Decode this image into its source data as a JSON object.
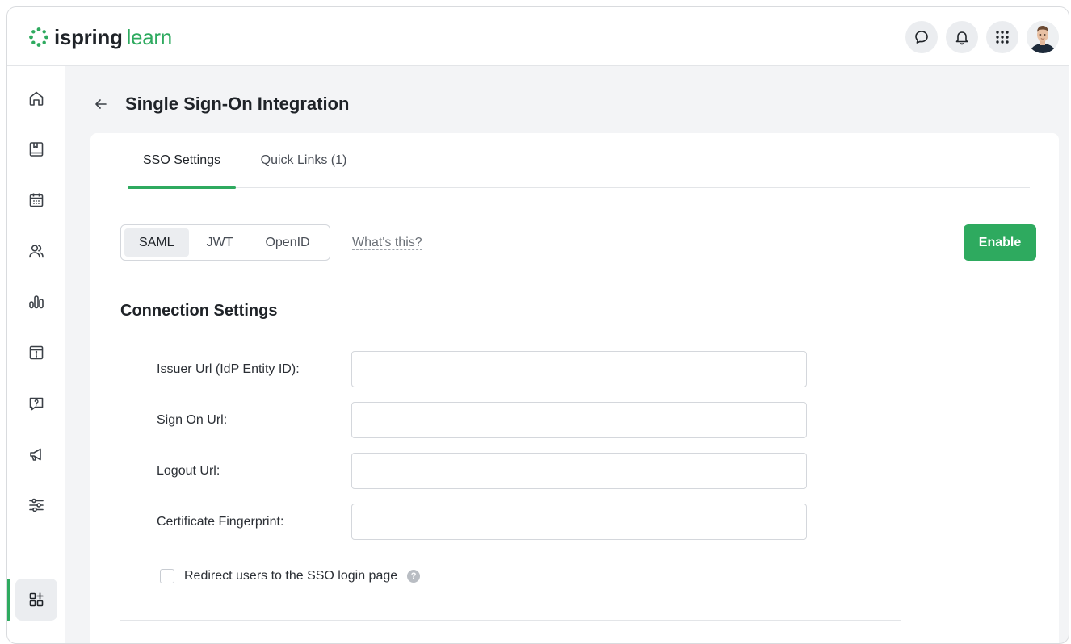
{
  "brand": {
    "name_bold": "ispring",
    "name_light": "learn",
    "accent_color": "#2eaa5f"
  },
  "header": {
    "icons": [
      "chat-icon",
      "bell-icon",
      "apps-grid-icon"
    ],
    "avatar": "user-avatar"
  },
  "sidebar": {
    "items": [
      {
        "icon": "home-icon",
        "active": false
      },
      {
        "icon": "book-icon",
        "active": false
      },
      {
        "icon": "calendar-icon",
        "active": false
      },
      {
        "icon": "users-icon",
        "active": false
      },
      {
        "icon": "reports-icon",
        "active": false
      },
      {
        "icon": "info-box-icon",
        "active": false
      },
      {
        "icon": "question-chat-icon",
        "active": false
      },
      {
        "icon": "megaphone-icon",
        "active": false
      },
      {
        "icon": "sliders-icon",
        "active": false
      },
      {
        "icon": "integrations-icon",
        "active": true
      }
    ]
  },
  "page": {
    "title": "Single Sign-On Integration"
  },
  "tabs": [
    {
      "label": "SSO Settings",
      "active": true
    },
    {
      "label": "Quick Links (1)",
      "active": false
    }
  ],
  "protocol": {
    "options": [
      {
        "label": "SAML",
        "active": true
      },
      {
        "label": "JWT",
        "active": false
      },
      {
        "label": "OpenID",
        "active": false
      }
    ],
    "help_link": "What's this?",
    "enable_label": "Enable"
  },
  "connection": {
    "title": "Connection Settings",
    "fields": [
      {
        "label": "Issuer Url (IdP Entity ID):",
        "value": "",
        "placeholder": ""
      },
      {
        "label": "Sign On Url:",
        "value": "",
        "placeholder": ""
      },
      {
        "label": "Logout Url:",
        "value": "",
        "placeholder": ""
      },
      {
        "label": "Certificate Fingerprint:",
        "value": "",
        "placeholder": ""
      }
    ],
    "redirect": {
      "label": "Redirect users to the SSO login page",
      "checked": false,
      "help_symbol": "?"
    }
  }
}
